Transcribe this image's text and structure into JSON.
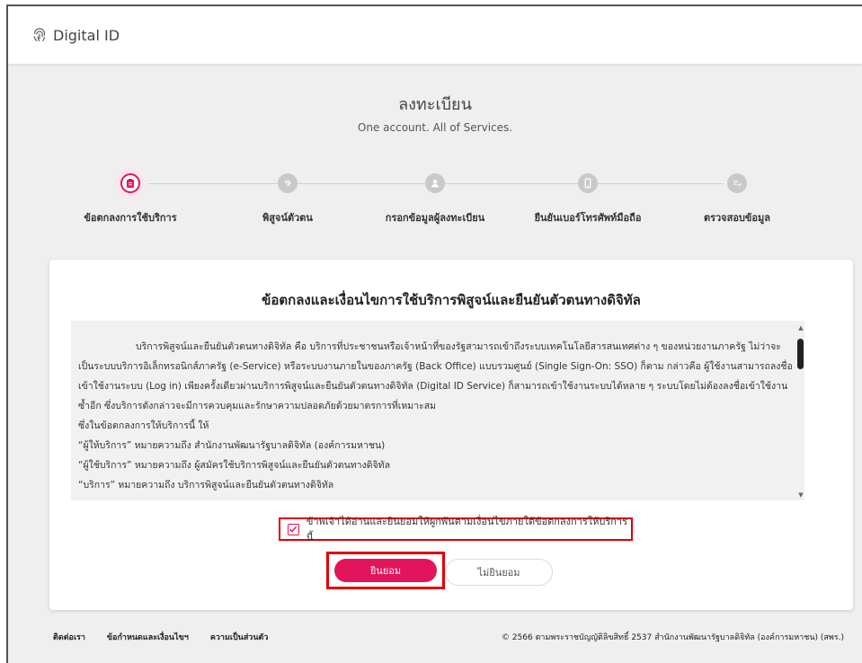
{
  "header": {
    "brand_text": "Digital ID",
    "brand_icon": "fingerprint-icon"
  },
  "page": {
    "title": "ลงทะเบียน",
    "subtitle": "One account. All of Services."
  },
  "stepper": {
    "steps": [
      {
        "label": "ข้อตกลงการใช้บริการ",
        "icon": "clipboard-icon",
        "active": true
      },
      {
        "label": "พิสูจน์ตัวตน",
        "icon": "fingerprint-icon",
        "active": false
      },
      {
        "label": "กรอกข้อมูลผู้ลงทะเบียน",
        "icon": "user-icon",
        "active": false
      },
      {
        "label": "ยืนยันเบอร์โทรศัพท์มือถือ",
        "icon": "phone-icon",
        "active": false
      },
      {
        "label": "ตรวจสอบข้อมูล",
        "icon": "review-icon",
        "active": false
      }
    ],
    "active_color": "#e2145b",
    "inactive_color": "#c9c9c9"
  },
  "terms": {
    "title": "ข้อตกลงและเงื่อนไขการใช้บริการพิสูจน์และยืนยันตัวตนทางดิจิทัล",
    "paragraph1": "บริการพิสูจน์และยืนยันตัวตนทางดิจิทัล คือ บริการที่ประชาชนหรือเจ้าหน้าที่ของรัฐสามารถเข้าถึงระบบเทคโนโลยีสารสนเทศต่าง ๆ ของหน่วยงานภาครัฐ ไม่ว่าจะเป็นระบบบริการอิเล็กทรอนิกส์ภาครัฐ (e-Service) หรือระบบงานภายในของภาครัฐ (Back Office) แบบรวมศูนย์ (Single Sign-On: SSO) ก็ตาม กล่าวคือ ผู้ใช้งานสามารถลงชื่อเข้าใช้งานระบบ (Log in) เพียงครั้งเดียวผ่านบริการพิสูจน์และยืนยันตัวตนทางดิจิทัล (Digital ID Service) ก็สามารถเข้าใช้งานระบบได้หลาย ๆ ระบบโดยไม่ต้องลงชื่อเข้าใช้งานซ้ำอีก ซึ่งบริการดังกล่าวจะมีการควบคุมและรักษาความปลอดภัยด้วยมาตรการที่เหมาะสม",
    "line_intro": "ซึ่งในข้อตกลงการให้บริการนี้ ให้",
    "line_provider": "“ผู้ให้บริการ” หมายความถึง สำนักงานพัฒนารัฐบาลดิจิทัล (องค์การมหาชน)",
    "line_user": "“ผู้ใช้บริการ” หมายความถึง ผู้สมัครใช้บริการพิสูจน์และยืนยันตัวตนทางดิจิทัล",
    "line_service": "“บริการ” หมายความถึง บริการพิสูจน์และยืนยันตัวตนทางดิจิทัล"
  },
  "agreement": {
    "checkbox_label": "ข้าพเจ้าได้อ่านและยินยอมให้ผูกพันตามเงื่อนไขภายใต้ข้อตกลงการให้บริการนี้",
    "checked": true,
    "accept_label": "ยินยอม",
    "decline_label": "ไม่ยินยอม"
  },
  "footer": {
    "links": [
      "ติดต่อเรา",
      "ข้อกำหนดและเงื่อนไขฯ",
      "ความเป็นส่วนตัว"
    ],
    "copyright": "© 2566 ตามพระราชบัญญัติลิขสิทธิ์ 2537 สำนักงานพัฒนารัฐบาลดิจิทัล (องค์การมหาชน) (สพร.)"
  }
}
